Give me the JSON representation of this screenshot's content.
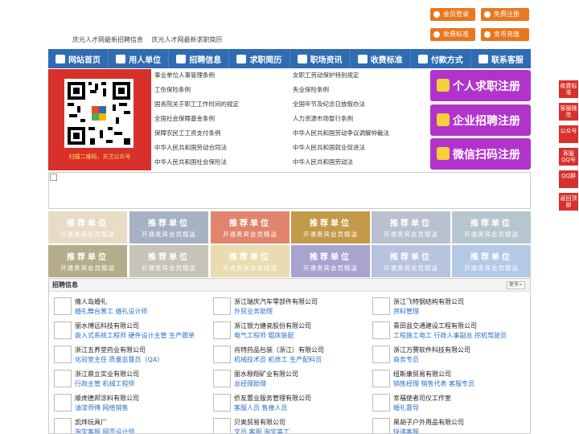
{
  "top_buttons": {
    "member_login": "会员登录",
    "free_register": "免费注册",
    "fee_standard": "收费标准",
    "coin_recharge": "金币充值"
  },
  "top_links": [
    "庆元人才网最新招聘信息",
    "庆元人才网最新求职简历"
  ],
  "nav": [
    {
      "label": "网站首页",
      "icon": "home-icon"
    },
    {
      "label": "用人单位",
      "icon": "building-icon"
    },
    {
      "label": "招聘信息",
      "icon": "chat-icon"
    },
    {
      "label": "求职简历",
      "icon": "resume-icon"
    },
    {
      "label": "职场资讯",
      "icon": "news-icon"
    },
    {
      "label": "收费标准",
      "icon": "fee-icon"
    },
    {
      "label": "付款方式",
      "icon": "payment-icon"
    },
    {
      "label": "联系客服",
      "icon": "phone-icon"
    }
  ],
  "qr": {
    "caption": "扫描二维码，关注公众号"
  },
  "policy_links_left": [
    "事业单位人事管理条例",
    "工伤保险条例",
    "国务院关于职工工作时间的规定",
    "全国社会保障基金条例",
    "保障农民工工资支付条例",
    "中华人民共和国劳动合同法",
    "中华人民共和国社会保险法"
  ],
  "policy_links_right": [
    "女职工劳动保护特别规定",
    "失业保险条例",
    "全国年节及纪念日放假办法",
    "人力资源市场暂行条例",
    "中华人民共和国劳动争议调解仲裁法",
    "中华人民共和国就业促进法",
    "中华人民共和国劳动法"
  ],
  "register_buttons": [
    "个人求职注册",
    "企业招聘注册",
    "微信扫码注册"
  ],
  "recommend": {
    "title": "推荐单位",
    "sub": "开通贵宾会员赠送"
  },
  "tile_colors": [
    "#e9dcc7",
    "#a6b2c4",
    "#e0856c",
    "#c39a4a",
    "#b9c0cf",
    "#b6c6cf",
    "#b5ac8c",
    "#c6c3b9",
    "#e9dcb0",
    "#a9a3d0",
    "#b7c3df",
    "#b3c9e6"
  ],
  "jobs": {
    "title": "招聘信息",
    "more": "更多>",
    "items": [
      {
        "company": "倩人岛婚礼",
        "positions": "婚礼舞台普工 婚礼设计师"
      },
      {
        "company": "浙江瑞庆汽车零部件有限公司",
        "positions": "外贸业务助理"
      },
      {
        "company": "浙江飞特钢结构有限公司",
        "positions": "资料管理"
      },
      {
        "company": "丽水博远科技有限公司",
        "positions": "嵌入式系统工程师 硬件设计主管 生产跟单"
      },
      {
        "company": "浙江银力搪瓷股份有限公司",
        "positions": "电气工程师 辊床装配"
      },
      {
        "company": "青田县交通建设工程有限公司",
        "positions": "工程施工电工 行政人事副总 挖机驾驶员"
      },
      {
        "company": "浙江五养堂药业有限公司",
        "positions": "化验室主任 质量监督员（QA）"
      },
      {
        "company": "肖特药品包装（浙江）有限公司",
        "positions": "机械技术员 机修工 生产配料员"
      },
      {
        "company": "浙江万赛软件科技有限公司",
        "positions": "商务专员"
      },
      {
        "company": "浙江鼎立实业有限公司",
        "positions": "行政主管 机械工程师"
      },
      {
        "company": "丽水穆翔矿业有限公司",
        "positions": "总经理助理"
      },
      {
        "company": "纽斯康贸易有限公司",
        "positions": "销售经理 销售代表 客服专员"
      },
      {
        "company": "顺虎德邦涂料有限公司",
        "positions": "油漆师傅 网络销售"
      },
      {
        "company": "侨友置业服务管理有限公司",
        "positions": "客服人员 售楼人员"
      },
      {
        "company": "幸福使者司仪工作室",
        "positions": "婚礼督导"
      },
      {
        "company": "凯烨玩具厂",
        "positions": "淘宝客服 网页设计师"
      },
      {
        "company": "贝奥贸易有限公司",
        "positions": "文员 客服 淘宝美工"
      },
      {
        "company": "黑胡子户外用品有限公司",
        "positions": "快递客服"
      }
    ]
  },
  "side_tabs": [
    "收费标准",
    "客服微信",
    "公众号",
    "客服QQ号",
    "QQ群",
    "返回顶部"
  ]
}
